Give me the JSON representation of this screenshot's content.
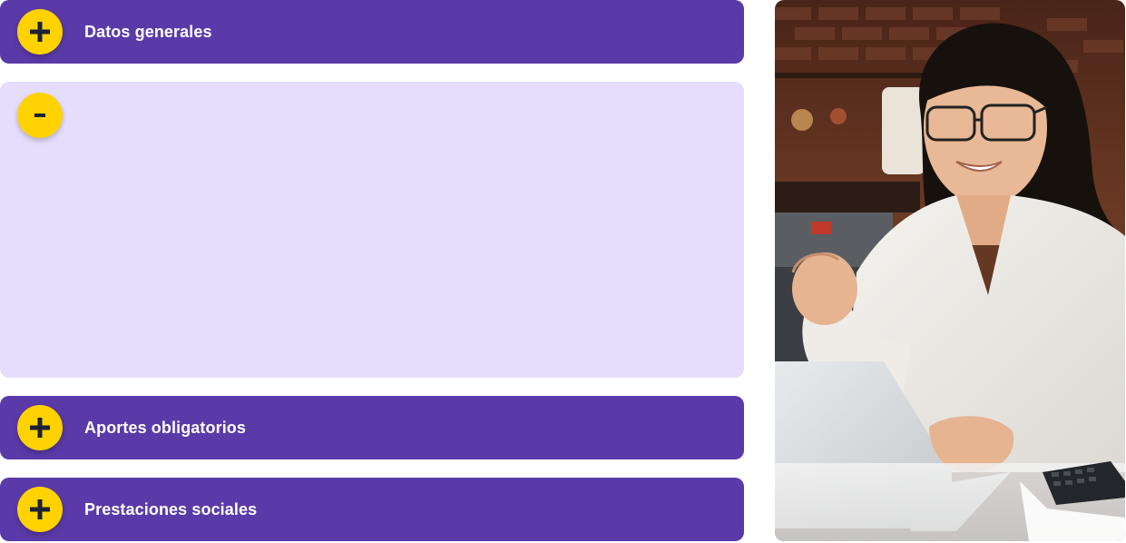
{
  "accordion": {
    "items": [
      {
        "label": "Datos generales",
        "state": "collapsed",
        "toggle_icon": "plus-icon"
      },
      {
        "label": "",
        "state": "expanded",
        "toggle_icon": "minus-icon"
      },
      {
        "label": "Aportes obligatorios",
        "state": "collapsed",
        "toggle_icon": "plus-icon"
      },
      {
        "label": "Prestaciones sociales",
        "state": "collapsed",
        "toggle_icon": "plus-icon"
      }
    ]
  },
  "colors": {
    "header_bg": "#5a3aa8",
    "expanded_bg": "#e6ddfc",
    "toggle_bg": "#ffd200",
    "toggle_glyph": "#1a2233",
    "label_text": "#ffffff"
  },
  "photo": {
    "subject": "woman-with-laptop-photo"
  }
}
